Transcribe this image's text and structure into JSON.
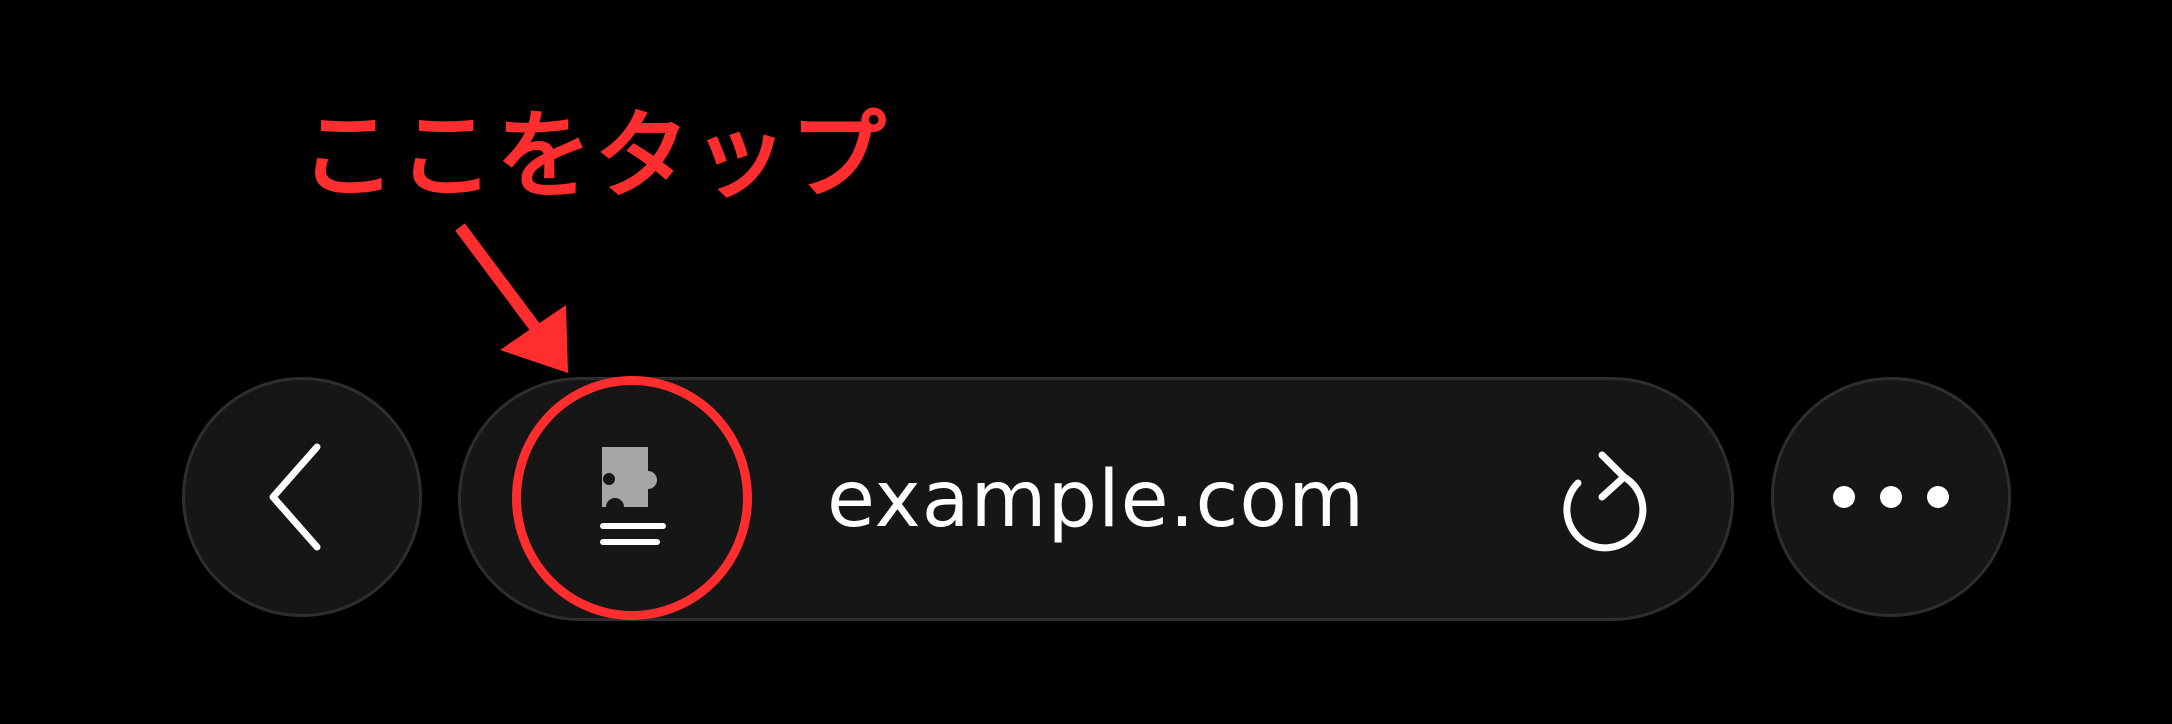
{
  "annotation": {
    "callout_text": "ここをタップ",
    "highlight_color": "#ff2d2d"
  },
  "toolbar": {
    "back_icon": "chevron-left-icon",
    "url_text": "example.com",
    "extension_icon": "puzzle-list-icon",
    "reload_icon": "reload-icon",
    "more_icon": "ellipsis-icon"
  },
  "colors": {
    "background": "#000000",
    "button_fill": "#161616",
    "button_border": "#2e2e2e",
    "icon_white": "#ffffff",
    "icon_gray": "#a6a6a6"
  }
}
